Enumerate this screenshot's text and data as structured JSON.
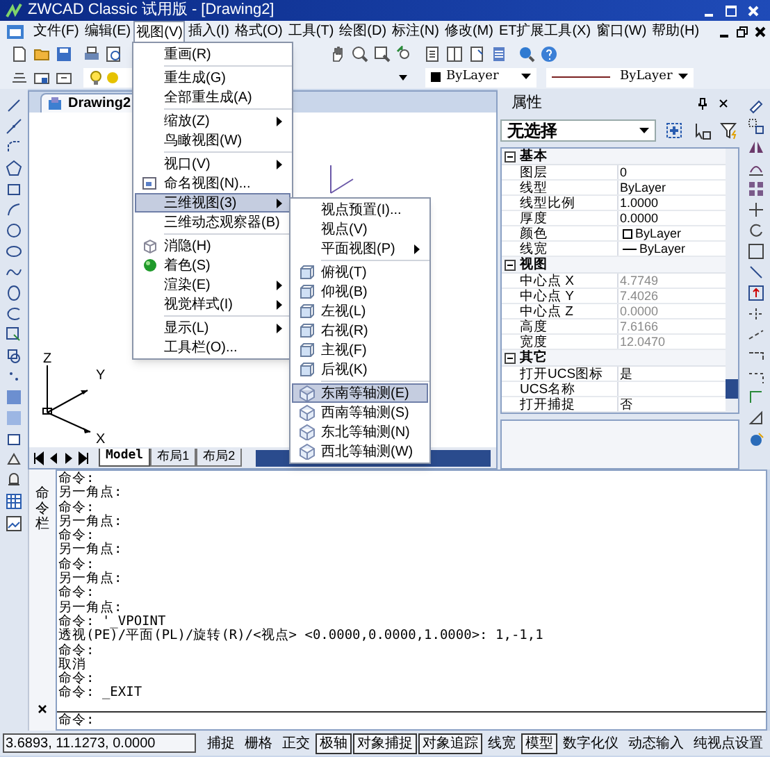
{
  "window": {
    "title": "ZWCAD Classic 试用版 - [Drawing2]"
  },
  "menu_bar": [
    {
      "label": "文件(F)",
      "selected": false
    },
    {
      "label": "编辑(E)",
      "selected": false
    },
    {
      "label": "视图(V)",
      "selected": true
    },
    {
      "label": "插入(I)",
      "selected": false
    },
    {
      "label": "格式(O)",
      "selected": false
    },
    {
      "label": "工具(T)",
      "selected": false
    },
    {
      "label": "绘图(D)",
      "selected": false
    },
    {
      "label": "标注(N)",
      "selected": false
    },
    {
      "label": "修改(M)",
      "selected": false
    },
    {
      "label": "ET扩展工具(X)",
      "selected": false
    },
    {
      "label": "窗口(W)",
      "selected": false
    },
    {
      "label": "帮助(H)",
      "selected": false
    }
  ],
  "properties_toolbar": {
    "color_control": "ByLayer",
    "linetype_control": "ByLayer"
  },
  "view_menu": [
    {
      "groups": [
        {
          "label": "重画(R)",
          "submenu": false,
          "selected": false
        }
      ]
    },
    {
      "groups": [
        {
          "label": "重生成(G)",
          "submenu": false,
          "selected": false
        },
        {
          "label": "全部重生成(A)",
          "submenu": false,
          "selected": false
        }
      ]
    },
    {
      "groups": [
        {
          "label": "缩放(Z)",
          "submenu": true,
          "selected": false
        },
        {
          "label": "鸟瞰视图(W)",
          "submenu": false,
          "selected": false
        }
      ]
    },
    {
      "groups": [
        {
          "label": "视口(V)",
          "submenu": true,
          "selected": false
        },
        {
          "label": "命名视图(N)...",
          "submenu": false,
          "selected": false
        },
        {
          "label": "三维视图(3)",
          "submenu": true,
          "selected": true
        },
        {
          "label": "三维动态观察器(B)",
          "submenu": false,
          "selected": false
        }
      ]
    },
    {
      "groups": [
        {
          "label": "消隐(H)",
          "submenu": false,
          "selected": false
        },
        {
          "label": "着色(S)",
          "submenu": false,
          "selected": false
        },
        {
          "label": "渲染(E)",
          "submenu": true,
          "selected": false
        },
        {
          "label": "视觉样式(I)",
          "submenu": true,
          "selected": false
        }
      ]
    },
    {
      "groups": [
        {
          "label": "显示(L)",
          "submenu": true,
          "selected": false
        },
        {
          "label": "工具栏(O)...",
          "submenu": false,
          "selected": false
        }
      ]
    }
  ],
  "view_3d_submenu": [
    {
      "groups": [
        {
          "label": "视点预置(I)...",
          "submenu": false,
          "selected": false
        },
        {
          "label": "视点(V)",
          "submenu": false,
          "selected": false
        },
        {
          "label": "平面视图(P)",
          "submenu": true,
          "selected": false
        }
      ]
    },
    {
      "groups": [
        {
          "label": "俯视(T)",
          "submenu": false,
          "selected": false
        },
        {
          "label": "仰视(B)",
          "submenu": false,
          "selected": false
        },
        {
          "label": "左视(L)",
          "submenu": false,
          "selected": false
        },
        {
          "label": "右视(R)",
          "submenu": false,
          "selected": false
        },
        {
          "label": "主视(F)",
          "submenu": false,
          "selected": false
        },
        {
          "label": "后视(K)",
          "submenu": false,
          "selected": false
        }
      ]
    },
    {
      "groups": [
        {
          "label": "东南等轴测(E)",
          "submenu": false,
          "selected": true
        },
        {
          "label": "西南等轴测(S)",
          "submenu": false,
          "selected": false
        },
        {
          "label": "东北等轴测(N)",
          "submenu": false,
          "selected": false
        },
        {
          "label": "西北等轴测(W)",
          "submenu": false,
          "selected": false
        }
      ]
    }
  ],
  "document_tab": "Drawing2",
  "ucs_axes": {
    "z": "Z",
    "y": "Y",
    "x": "X"
  },
  "layout_tabs": [
    {
      "label": "Model",
      "selected": true
    },
    {
      "label": "布局1",
      "selected": false
    },
    {
      "label": "布局2",
      "selected": false
    }
  ],
  "properties_panel": {
    "title": "属性",
    "selection": "无选择",
    "sections": [
      {
        "title": "基本",
        "expanded": true,
        "rows": [
          {
            "name": "图层",
            "value": "0",
            "disabled": false
          },
          {
            "name": "线型",
            "value": "ByLayer",
            "disabled": false
          },
          {
            "name": "线型比例",
            "value": "1.0000",
            "disabled": false
          },
          {
            "name": "厚度",
            "value": "0.0000",
            "disabled": false
          },
          {
            "name": "颜色",
            "value": "ByLayer",
            "disabled": false,
            "kind": "color"
          },
          {
            "name": "线宽",
            "value": "ByLayer",
            "disabled": false,
            "kind": "lineweight"
          }
        ]
      },
      {
        "title": "视图",
        "expanded": true,
        "rows": [
          {
            "name": "中心点 X",
            "value": "4.7749",
            "disabled": true
          },
          {
            "name": "中心点 Y",
            "value": "7.4026",
            "disabled": true
          },
          {
            "name": "中心点 Z",
            "value": "0.0000",
            "disabled": true
          },
          {
            "name": "高度",
            "value": "7.6166",
            "disabled": true
          },
          {
            "name": "宽度",
            "value": "12.0470",
            "disabled": true
          }
        ]
      },
      {
        "title": "其它",
        "expanded": true,
        "rows": [
          {
            "name": "打开UCS图标",
            "value": "是",
            "disabled": false
          },
          {
            "name": "UCS名称",
            "disabled": false
          },
          {
            "name": "打开捕捉",
            "value": "否",
            "disabled": false
          }
        ]
      }
    ]
  },
  "command_window": {
    "label": "命令栏",
    "history": [
      "命令:",
      "另一角点:",
      "命令:",
      "另一角点:",
      "命令:",
      "另一角点:",
      "命令:",
      "另一角点:",
      "命令:",
      "另一角点:",
      "命令: '_VPOINT",
      "透视(PE)/平面(PL)/旋转(R)/<视点> <0.0000,0.0000,1.0000>: 1,-1,1",
      "命令:",
      "取消",
      "命令:",
      "命令: _EXIT"
    ],
    "prompt": "命令:"
  },
  "status_bar": {
    "coordinates": "3.6893,  11.1273,  0.0000",
    "toggles": [
      {
        "label": "捕捉",
        "on": false
      },
      {
        "label": "栅格",
        "on": false
      },
      {
        "label": "正交",
        "on": false
      },
      {
        "label": "极轴",
        "on": true
      },
      {
        "label": "对象捕捉",
        "on": true
      },
      {
        "label": "对象追踪",
        "on": true
      },
      {
        "label": "线宽",
        "on": false
      },
      {
        "label": "模型",
        "on": true
      },
      {
        "label": "数字化仪",
        "on": false
      },
      {
        "label": "动态输入",
        "on": false
      },
      {
        "label": "纯视点设置",
        "on": false
      }
    ]
  }
}
